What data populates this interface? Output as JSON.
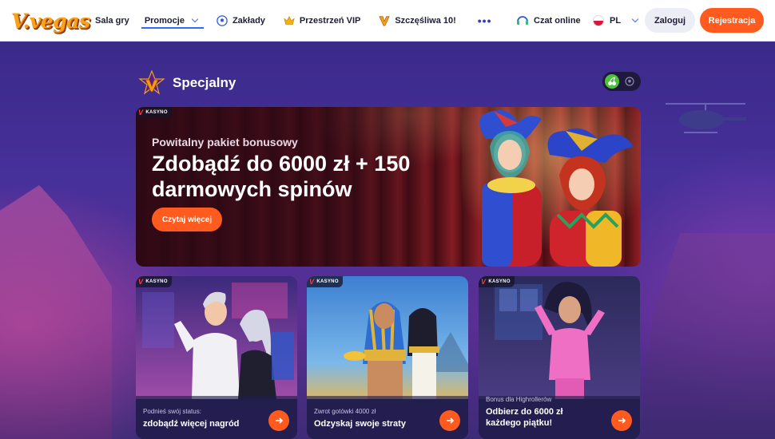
{
  "header": {
    "logo_text": "V.vegas",
    "nav": [
      {
        "label": "Sala gry"
      },
      {
        "label": "Promocje"
      },
      {
        "label": "Zakłady"
      },
      {
        "label": "Przestrzeń VIP"
      },
      {
        "label": "Szczęśliwa 10!"
      }
    ],
    "more": "•••",
    "chat_label": "Czat online",
    "lang_label": "PL",
    "login_label": "Zaloguj",
    "register_label": "Rejestracja"
  },
  "section": {
    "title": "Specjalny"
  },
  "hero": {
    "tag": "KASYNO",
    "subtitle": "Powitalny pakiet bonusowy",
    "title": "Zdobądź do 6000 zł + 150 darmowych spinów",
    "button_label": "Czytaj więcej"
  },
  "cards": [
    {
      "tag": "KASYNO",
      "subtitle": "Podnieś swój status:",
      "title": "zdobądź więcej nagród"
    },
    {
      "tag": "KASYNO",
      "subtitle": "Zwrot gotówki 4000 zł",
      "title": "Odzyskaj swoje straty"
    },
    {
      "tag": "KASYNO",
      "subtitle": "Bonus dla Highrollerów",
      "title": "Odbierz do 6000 zł każdego piątku!"
    }
  ],
  "colors": {
    "accent": "#ff5b1f",
    "nav_underline": "#2f6bff",
    "background": "#3b2a8a",
    "toggle_on": "#4cc23a"
  }
}
